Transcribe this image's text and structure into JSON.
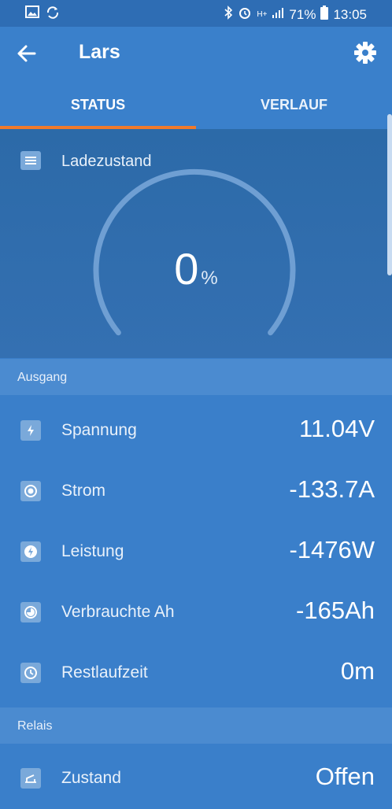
{
  "status_bar": {
    "battery_percent": "71%",
    "time": "13:05",
    "network": "H+"
  },
  "app_bar": {
    "title": "Lars"
  },
  "tabs": [
    {
      "label": "STATUS",
      "active": true
    },
    {
      "label": "VERLAUF",
      "active": false
    }
  ],
  "gauge": {
    "label": "Ladezustand",
    "value": "0",
    "unit": "%",
    "fraction": 0
  },
  "sections": {
    "ausgang": {
      "title": "Ausgang",
      "rows": [
        {
          "label": "Spannung",
          "value": "11.04V",
          "icon": "battery-charging-icon"
        },
        {
          "label": "Strom",
          "value": "-133.7A",
          "icon": "current-icon"
        },
        {
          "label": "Leistung",
          "value": "-1476W",
          "icon": "power-icon"
        },
        {
          "label": "Verbrauchte Ah",
          "value": "-165Ah",
          "icon": "consumed-icon"
        },
        {
          "label": "Restlaufzeit",
          "value": "0m",
          "icon": "clock-icon"
        }
      ]
    },
    "relais": {
      "title": "Relais",
      "rows": [
        {
          "label": "Zustand",
          "value": "Offen",
          "icon": "relay-open-icon"
        }
      ]
    }
  },
  "colors": {
    "primary": "#3a80cb",
    "tab_indicator": "#f07a2b"
  }
}
